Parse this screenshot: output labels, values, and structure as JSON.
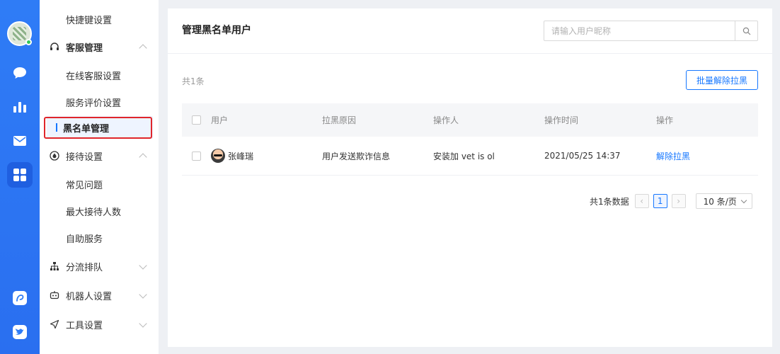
{
  "colors": {
    "rail_bg": "#2f7cf6",
    "accent": "#1677ff",
    "highlight_border": "#e0262b",
    "online": "#34c759"
  },
  "rail": {
    "items": [
      {
        "icon": "chat-bubble-icon"
      },
      {
        "icon": "bar-chart-icon"
      },
      {
        "icon": "mail-icon"
      },
      {
        "icon": "apps-grid-icon",
        "active": true
      },
      {
        "icon": "app-badge-icon"
      },
      {
        "icon": "bird-icon"
      }
    ]
  },
  "sidebar": {
    "shortcut_settings": "快捷键设置",
    "service_group": "客服管理",
    "online_service": "在线客服设置",
    "service_rating": "服务评价设置",
    "blacklist": "黑名单管理",
    "reception_group": "接待设置",
    "faq": "常见问题",
    "max_reception": "最大接待人数",
    "self_service": "自助服务",
    "routing_group": "分流排队",
    "robot_group": "机器人设置",
    "tools_group": "工具设置"
  },
  "main": {
    "title": "管理黑名单用户",
    "search_placeholder": "请输入用户昵称",
    "total_text": "共1条",
    "batch_unblock": "批量解除拉黑",
    "columns": [
      "用户",
      "拉黑原因",
      "操作人",
      "操作时间",
      "操作"
    ],
    "rows": [
      {
        "user": "张峰瑞",
        "reason": "用户发送欺诈信息",
        "operator": "安装加 vet is ol",
        "time": "2021/05/25 14:37",
        "action": "解除拉黑"
      }
    ],
    "pagination": {
      "total": "共1条数据",
      "prev": "‹",
      "page": "1",
      "next": "›",
      "page_size": "10 条/页"
    }
  }
}
